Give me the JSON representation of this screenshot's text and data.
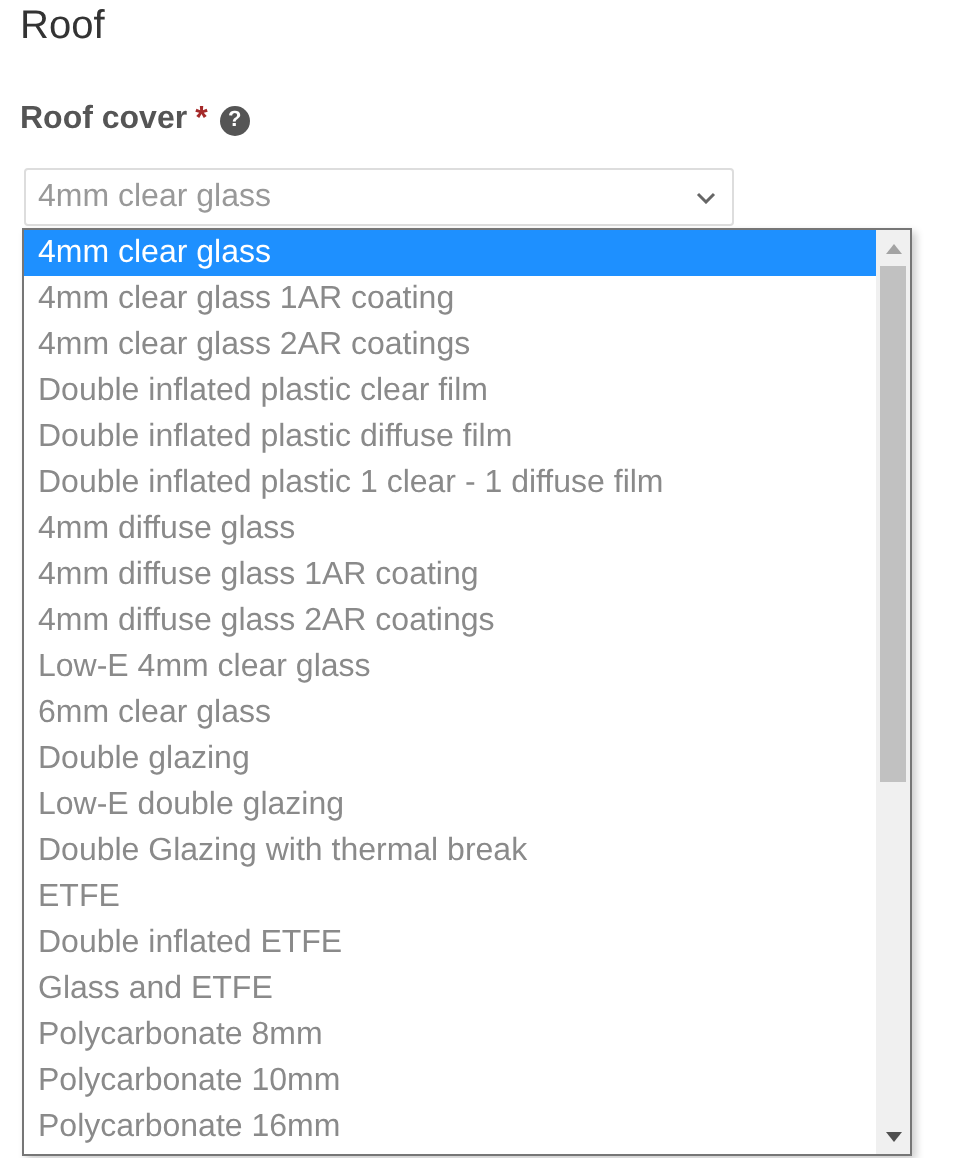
{
  "section": {
    "title": "Roof"
  },
  "field": {
    "label": "Roof cover",
    "required_mark": "*",
    "help_icon": "?",
    "value": "4mm clear glass"
  },
  "dropdown": {
    "options": [
      {
        "label": "4mm clear glass",
        "selected": true
      },
      {
        "label": "4mm clear glass 1AR coating",
        "selected": false
      },
      {
        "label": "4mm clear glass 2AR coatings",
        "selected": false
      },
      {
        "label": "Double inflated plastic clear film",
        "selected": false
      },
      {
        "label": "Double inflated plastic diffuse film",
        "selected": false
      },
      {
        "label": "Double inflated plastic 1 clear - 1 diffuse film",
        "selected": false
      },
      {
        "label": "4mm diffuse glass",
        "selected": false
      },
      {
        "label": "4mm diffuse glass 1AR coating",
        "selected": false
      },
      {
        "label": "4mm diffuse glass 2AR coatings",
        "selected": false
      },
      {
        "label": "Low-E 4mm clear glass",
        "selected": false
      },
      {
        "label": "6mm clear glass",
        "selected": false
      },
      {
        "label": "Double glazing",
        "selected": false
      },
      {
        "label": "Low-E double glazing",
        "selected": false
      },
      {
        "label": "Double Glazing with thermal break",
        "selected": false
      },
      {
        "label": "ETFE",
        "selected": false
      },
      {
        "label": "Double inflated ETFE",
        "selected": false
      },
      {
        "label": "Glass and ETFE",
        "selected": false
      },
      {
        "label": "Polycarbonate 8mm",
        "selected": false
      },
      {
        "label": "Polycarbonate 10mm",
        "selected": false
      },
      {
        "label": "Polycarbonate 16mm",
        "selected": false
      }
    ]
  }
}
